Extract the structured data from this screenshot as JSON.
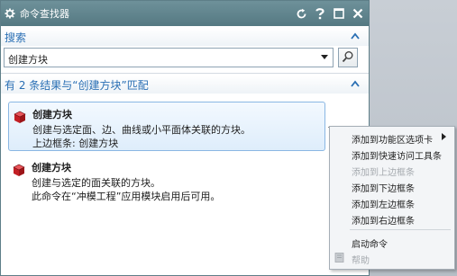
{
  "dialog": {
    "title": "命令查找器",
    "title_buttons": [
      "reset-icon",
      "help-icon",
      "restore-icon",
      "close-icon"
    ]
  },
  "search": {
    "header": "搜索",
    "value": "创建方块"
  },
  "results": {
    "header": "有 2 条结果与“创建方块”匹配",
    "items": [
      {
        "title": "创建方块",
        "line1": "创建与选定面、边、曲线或小平面体关联的方块。",
        "line2": "上边框条: 创建方块"
      },
      {
        "title": "创建方块",
        "line1": "创建与选定的面关联的方块。",
        "line2": "此命令在“冲模工程”应用模块启用后可用。"
      }
    ]
  },
  "context_menu": {
    "items": [
      {
        "label": "添加到功能区选项卡",
        "enabled": true,
        "submenu": true
      },
      {
        "label": "添加到快速访问工具条",
        "enabled": true
      },
      {
        "label": "添加到上边框条",
        "enabled": false
      },
      {
        "label": "添加到下边框条",
        "enabled": true
      },
      {
        "label": "添加到左边框条",
        "enabled": true
      },
      {
        "label": "添加到右边框条",
        "enabled": true
      },
      {
        "label": "启动命令",
        "enabled": true
      },
      {
        "label": "帮助",
        "enabled": false,
        "icon": "help-book-icon"
      }
    ]
  },
  "colors": {
    "titlebar": "#557982",
    "section_header": "#2a6fb4",
    "selection_border": "#8ab7e3",
    "icon_red": "#d0262b"
  }
}
